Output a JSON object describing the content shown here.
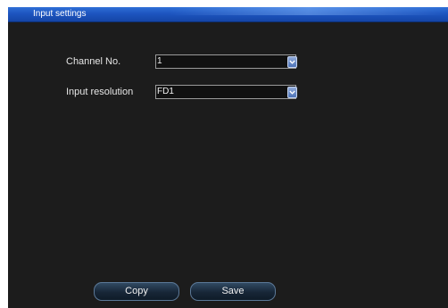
{
  "window": {
    "title": "Input settings"
  },
  "form": {
    "channel": {
      "label": "Channel No.",
      "value": "1"
    },
    "resolution": {
      "label": "Input resolution",
      "value": "FD1"
    }
  },
  "buttons": {
    "copy_label": "Copy",
    "save_label": "Save"
  },
  "colors": {
    "titlebar": "#1d55c0",
    "background": "#1c1c1c",
    "combo_border": "#9a9a9a"
  },
  "icons": {
    "dropdown": "chevron-down-icon"
  }
}
